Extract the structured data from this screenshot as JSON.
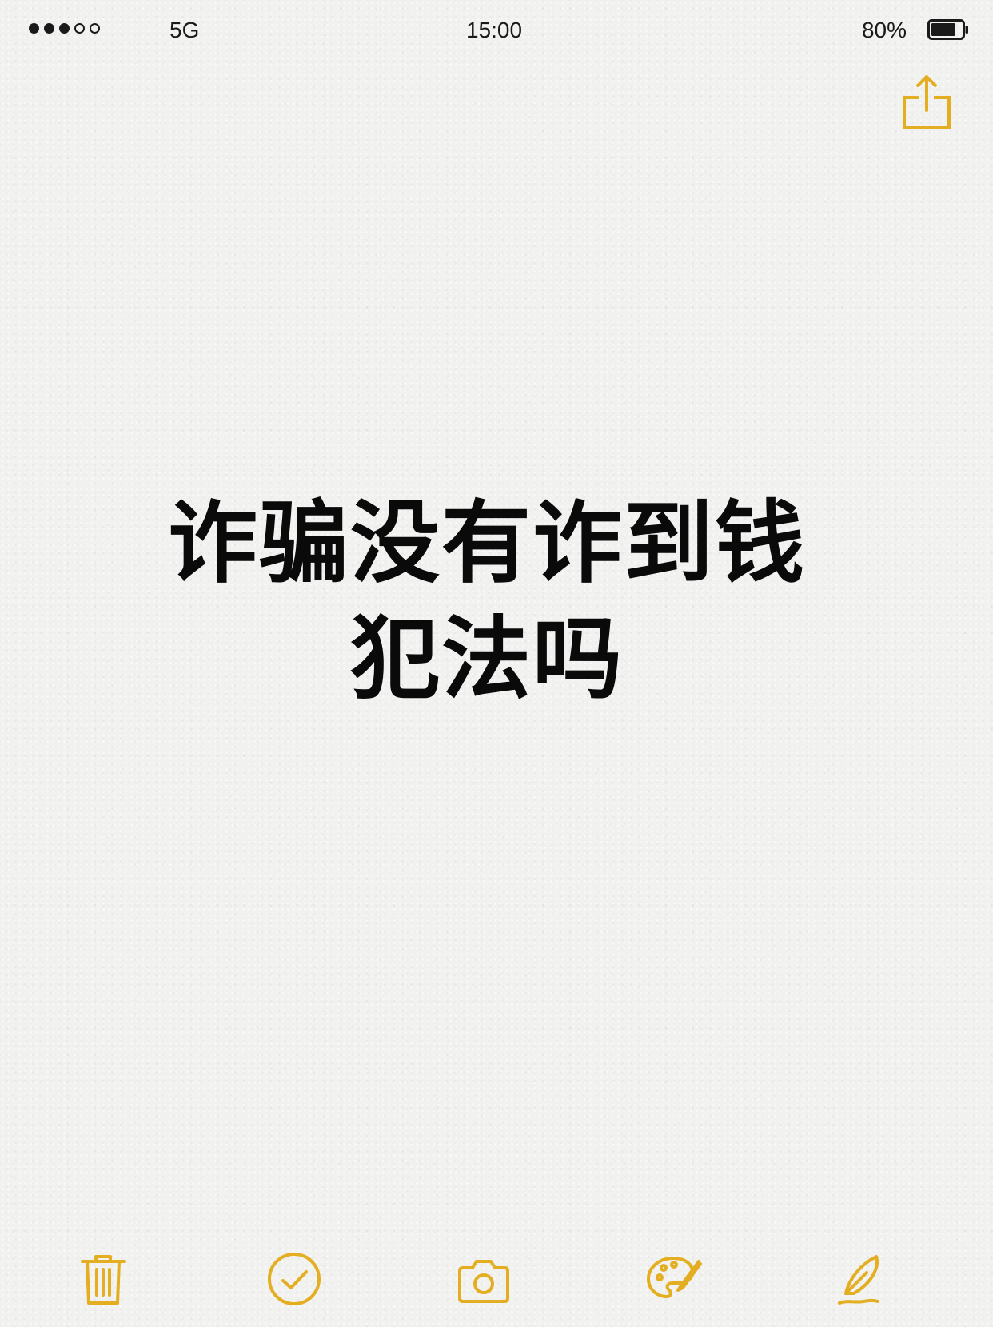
{
  "status_bar": {
    "signal_dots_filled": 3,
    "signal_dots_total": 5,
    "network": "5G",
    "time": "15:00",
    "battery_percent": "80%",
    "battery_level": 0.8
  },
  "header": {
    "share_icon": "share-icon"
  },
  "note": {
    "title_line1": "诈骗没有诈到钱",
    "title_line2": "犯法吗"
  },
  "toolbar": {
    "icons": [
      "trash-icon",
      "checklist-icon",
      "camera-icon",
      "markup-palette-icon",
      "pen-icon"
    ]
  },
  "colors": {
    "accent": "#e3ae22",
    "text": "#0a0a0a",
    "background": "#f1f1f0"
  }
}
